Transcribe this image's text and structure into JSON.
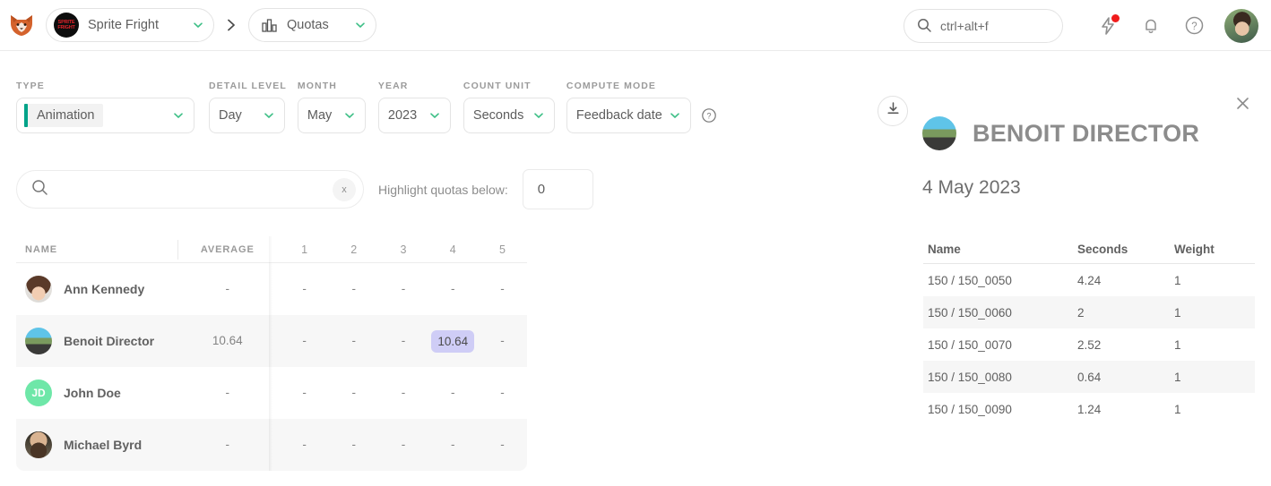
{
  "header": {
    "logo_icon": "fox-logo-icon",
    "project": {
      "name": "Sprite Fright",
      "avatar_text": "SPRITE FRIGHT"
    },
    "section": {
      "name": "Quotas",
      "icon": "chart-bars-icon"
    },
    "breadcrumb_separator": "›",
    "search": {
      "value": "ctrl+alt+f",
      "placeholder": "ctrl+alt+f",
      "icon": "search-icon"
    },
    "icons": {
      "activity": "lightning-bolt-icon",
      "notifications": "bell-icon",
      "help": "question-circle-icon",
      "avatar": "user-avatar"
    }
  },
  "filters": [
    {
      "label": "TYPE",
      "value": "Animation",
      "name": "type"
    },
    {
      "label": "DETAIL LEVEL",
      "value": "Day",
      "name": "detail-level"
    },
    {
      "label": "MONTH",
      "value": "May",
      "name": "month"
    },
    {
      "label": "YEAR",
      "value": "2023",
      "name": "year"
    },
    {
      "label": "COUNT UNIT",
      "value": "Seconds",
      "name": "count-unit"
    },
    {
      "label": "COMPUTE MODE",
      "value": "Feedback date",
      "name": "compute-mode"
    }
  ],
  "filters_map": {
    "type_label": "TYPE",
    "type_value": "Animation",
    "detail_label": "DETAIL LEVEL",
    "detail_value": "Day",
    "month_label": "MONTH",
    "month_value": "May",
    "year_label": "YEAR",
    "year_value": "2023",
    "count_label": "COUNT UNIT",
    "count_value": "Seconds",
    "mode_label": "COMPUTE MODE",
    "mode_value": "Feedback date",
    "help_icon": "question-circle-icon"
  },
  "toolbar": {
    "search_value": "",
    "search_placeholder": "",
    "clear_label": "x",
    "highlight_label": "Highlight quotas below:",
    "highlight_value": "0"
  },
  "quotas_table": {
    "columns": [
      "NAME",
      "AVERAGE",
      "1",
      "2",
      "3",
      "4",
      "5"
    ],
    "rows": [
      {
        "name": "Ann Kennedy",
        "average": "-",
        "days": [
          "-",
          "-",
          "-",
          "-",
          "-"
        ],
        "highlight_index": -1,
        "avatar_class": "av-ann",
        "initials": ""
      },
      {
        "name": "Benoit Director",
        "average": "10.64",
        "days": [
          "-",
          "-",
          "-",
          "10.64",
          "-"
        ],
        "highlight_index": 3,
        "avatar_class": "av-benoit",
        "initials": ""
      },
      {
        "name": "John Doe",
        "average": "-",
        "days": [
          "-",
          "-",
          "-",
          "-",
          "-"
        ],
        "highlight_index": -1,
        "avatar_class": "av-jd",
        "initials": "JD"
      },
      {
        "name": "Michael Byrd",
        "average": "-",
        "days": [
          "-",
          "-",
          "-",
          "-",
          "-"
        ],
        "highlight_index": -1,
        "avatar_class": "av-michael",
        "initials": ""
      }
    ]
  },
  "detail_panel": {
    "download_icon": "download-icon",
    "close_icon": "close-icon",
    "title": "BENOIT DIRECTOR",
    "date": "4 May 2023",
    "avatar_class": "av-benoit",
    "columns": [
      "Name",
      "Seconds",
      "Weight"
    ],
    "rows": [
      {
        "name": "150 / 150_0050",
        "seconds": "4.24",
        "weight": "1"
      },
      {
        "name": "150 / 150_0060",
        "seconds": "2",
        "weight": "1"
      },
      {
        "name": "150 / 150_0070",
        "seconds": "2.52",
        "weight": "1"
      },
      {
        "name": "150 / 150_0080",
        "seconds": "0.64",
        "weight": "1"
      },
      {
        "name": "150 / 150_0090",
        "seconds": "1.24",
        "weight": "1"
      }
    ]
  },
  "colors": {
    "accent_teal": "#00a389",
    "highlight_cell": "#cfcdf6",
    "notification_dot": "#f01c1c",
    "chevron_green": "#3dbf86",
    "jd_avatar": "#6ee7a8"
  }
}
